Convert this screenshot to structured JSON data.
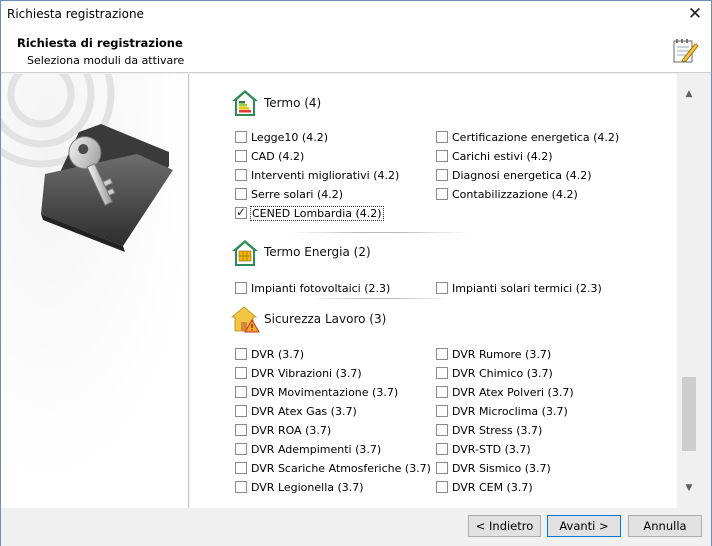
{
  "window": {
    "title": "Richiesta registrazione",
    "close_glyph": "✕"
  },
  "header": {
    "title": "Richiesta di registrazione",
    "subtitle": "Seleziona moduli da attivare"
  },
  "sections": [
    {
      "title": "Termo (4)",
      "icon": "energy-house-icon",
      "items": [
        {
          "label": "Legge10 (4.2)",
          "checked": false
        },
        {
          "label": "Certificazione energetica (4.2)",
          "checked": false
        },
        {
          "label": "CAD (4.2)",
          "checked": false
        },
        {
          "label": "Carichi estivi (4.2)",
          "checked": false
        },
        {
          "label": "Interventi migliorativi (4.2)",
          "checked": false
        },
        {
          "label": "Diagnosi energetica (4.2)",
          "checked": false
        },
        {
          "label": "Serre solari (4.2)",
          "checked": false
        },
        {
          "label": "Contabilizzazione (4.2)",
          "checked": false
        },
        {
          "label": "CENED Lombardia (4.2)",
          "checked": true
        }
      ]
    },
    {
      "title": "Termo Energia (2)",
      "icon": "solar-house-icon",
      "items": [
        {
          "label": "Impianti fotovoltaici (2.3)",
          "checked": false
        },
        {
          "label": "Impianti solari termici (2.3)",
          "checked": false
        }
      ]
    },
    {
      "title": "Sicurezza Lavoro (3)",
      "icon": "warning-house-icon",
      "items": [
        {
          "label": "DVR (3.7)",
          "checked": false
        },
        {
          "label": "DVR Rumore (3.7)",
          "checked": false
        },
        {
          "label": "DVR Vibrazioni (3.7)",
          "checked": false
        },
        {
          "label": "DVR Chimico (3.7)",
          "checked": false
        },
        {
          "label": "DVR Movimentazione (3.7)",
          "checked": false
        },
        {
          "label": "DVR Atex Polveri (3.7)",
          "checked": false
        },
        {
          "label": "DVR Atex Gas (3.7)",
          "checked": false
        },
        {
          "label": "DVR Microclima (3.7)",
          "checked": false
        },
        {
          "label": "DVR ROA (3.7)",
          "checked": false
        },
        {
          "label": "DVR Stress (3.7)",
          "checked": false
        },
        {
          "label": "DVR Adempimenti (3.7)",
          "checked": false
        },
        {
          "label": "DVR-STD (3.7)",
          "checked": false
        },
        {
          "label": "DVR Scariche Atmosferiche (3.7)",
          "checked": false
        },
        {
          "label": "DVR Sismico (3.7)",
          "checked": false
        },
        {
          "label": "DVR Legionella (3.7)",
          "checked": false
        },
        {
          "label": "DVR CEM (3.7)",
          "checked": false
        }
      ]
    }
  ],
  "scrollbar": {
    "up_glyph": "▲",
    "down_glyph": "▼"
  },
  "buttons": {
    "back": "< Indietro",
    "next": "Avanti >",
    "cancel": "Annulla"
  }
}
